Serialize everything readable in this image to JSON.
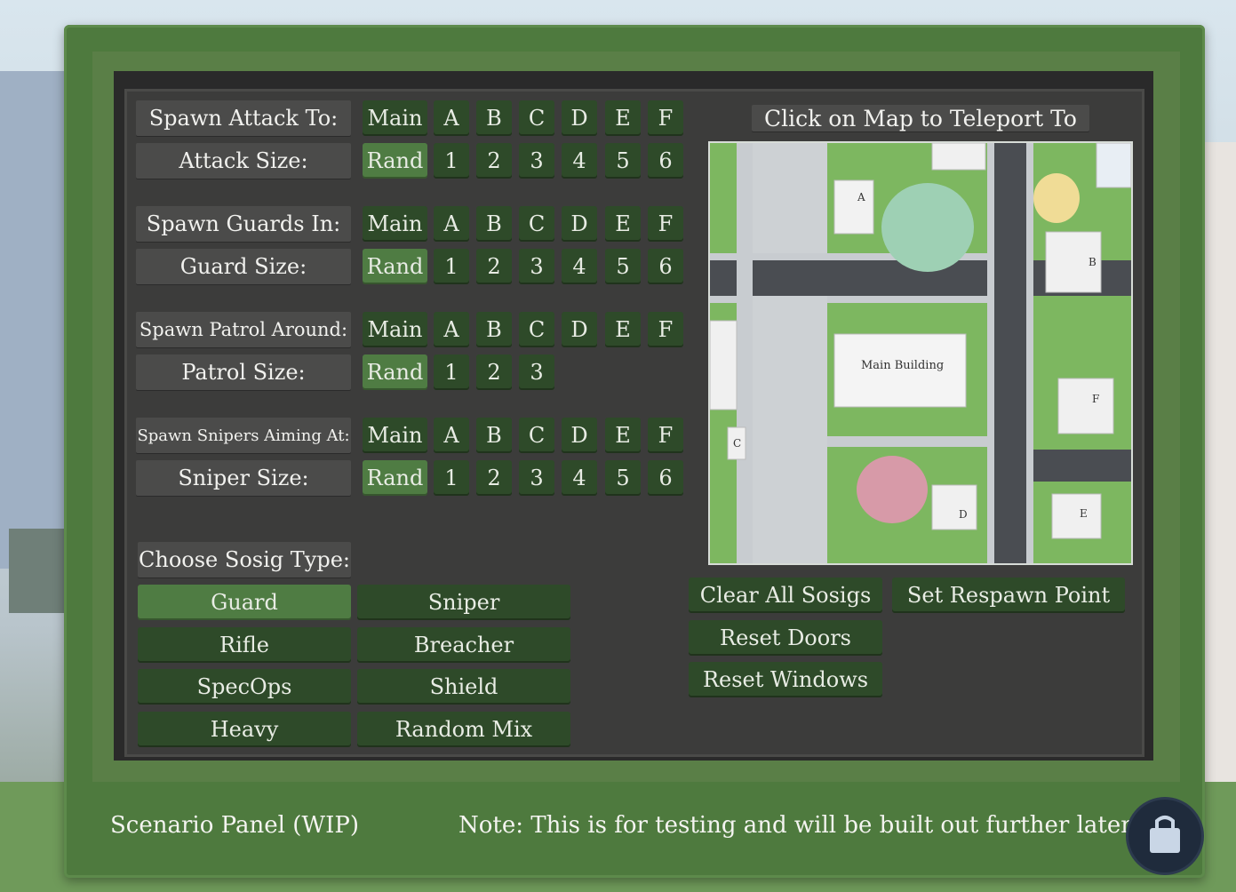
{
  "panel": {
    "title": "Scenario Panel (WIP)",
    "note": "Note: This is for testing and will be built out further later.",
    "map_title": "Click on Map to Teleport To"
  },
  "rows": [
    {
      "label": "Spawn Attack To:",
      "options": [
        "Main",
        "A",
        "B",
        "C",
        "D",
        "E",
        "F"
      ]
    },
    {
      "label": "Attack Size:",
      "options": [
        "Rand",
        "1",
        "2",
        "3",
        "4",
        "5",
        "6"
      ],
      "selected": "Rand"
    },
    {
      "label": "Spawn Guards In:",
      "options": [
        "Main",
        "A",
        "B",
        "C",
        "D",
        "E",
        "F"
      ]
    },
    {
      "label": "Guard Size:",
      "options": [
        "Rand",
        "1",
        "2",
        "3",
        "4",
        "5",
        "6"
      ],
      "selected": "Rand"
    },
    {
      "label": "Spawn Patrol Around:",
      "options": [
        "Main",
        "A",
        "B",
        "C",
        "D",
        "E",
        "F"
      ]
    },
    {
      "label": "Patrol Size:",
      "options": [
        "Rand",
        "1",
        "2",
        "3"
      ],
      "selected": "Rand"
    },
    {
      "label": "Spawn Snipers Aiming At:",
      "options": [
        "Main",
        "A",
        "B",
        "C",
        "D",
        "E",
        "F"
      ]
    },
    {
      "label": "Sniper Size:",
      "options": [
        "Rand",
        "1",
        "2",
        "3",
        "4",
        "5",
        "6"
      ],
      "selected": "Rand"
    }
  ],
  "sosig": {
    "label": "Choose Sosig Type:",
    "types": [
      "Guard",
      "Sniper",
      "Rifle",
      "Breacher",
      "SpecOps",
      "Shield",
      "Heavy",
      "Random Mix"
    ],
    "selected": "Guard"
  },
  "actions": {
    "clear": "Clear All Sosigs",
    "respawn": "Set Respawn Point",
    "doors": "Reset Doors",
    "windows": "Reset Windows"
  },
  "map_labels": {
    "a": "A",
    "b": "B",
    "c": "C",
    "d": "D",
    "e": "E",
    "f": "F",
    "main": "Main Building"
  },
  "colors": {
    "frame": "#4e7a3e",
    "button": "#2e4a29",
    "button_selected": "#4f7c43",
    "label_bg": "#4b4b4a",
    "panel_bg": "#3c3c3b"
  }
}
